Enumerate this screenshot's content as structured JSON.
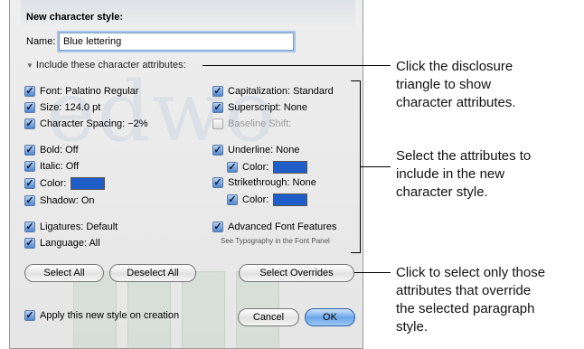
{
  "dialog": {
    "title": "New character style:",
    "name_label": "Name:",
    "name_value": "Blue lettering",
    "disclosure_label": "Include these character attributes:"
  },
  "attributes": {
    "font": "Font: Palatino Regular",
    "size": "Size: 124.0 pt",
    "spacing": "Character Spacing: −2%",
    "bold": "Bold: Off",
    "italic": "Italic: Off",
    "color": "Color:",
    "shadow": "Shadow: On",
    "ligatures": "Ligatures: Default",
    "language": "Language: All",
    "capitalization": "Capitalization: Standard",
    "superscript": "Superscript: None",
    "baseline": "Baseline Shift:",
    "underline": "Underline: None",
    "underline_color": "Color:",
    "strikethrough": "Strikethrough: None",
    "strike_color": "Color:",
    "advanced": "Advanced Font Features",
    "advanced_note": "See Typography in the Font Panel"
  },
  "buttons": {
    "select_all": "Select All",
    "deselect_all": "Deselect All",
    "select_overrides": "Select Overrides",
    "cancel": "Cancel",
    "ok": "OK"
  },
  "apply_label": "Apply this new style on creation",
  "colors": {
    "swatch": "#1f5ec8",
    "accent": "#4f86cc"
  },
  "callouts": {
    "c1": [
      "Click the disclosure",
      "triangle to show",
      "character attributes."
    ],
    "c2": [
      "Select the attributes to",
      "include in the new",
      "character style."
    ],
    "c3": [
      "Click to select only those",
      "attributes that override",
      "the selected paragraph",
      "style."
    ]
  }
}
